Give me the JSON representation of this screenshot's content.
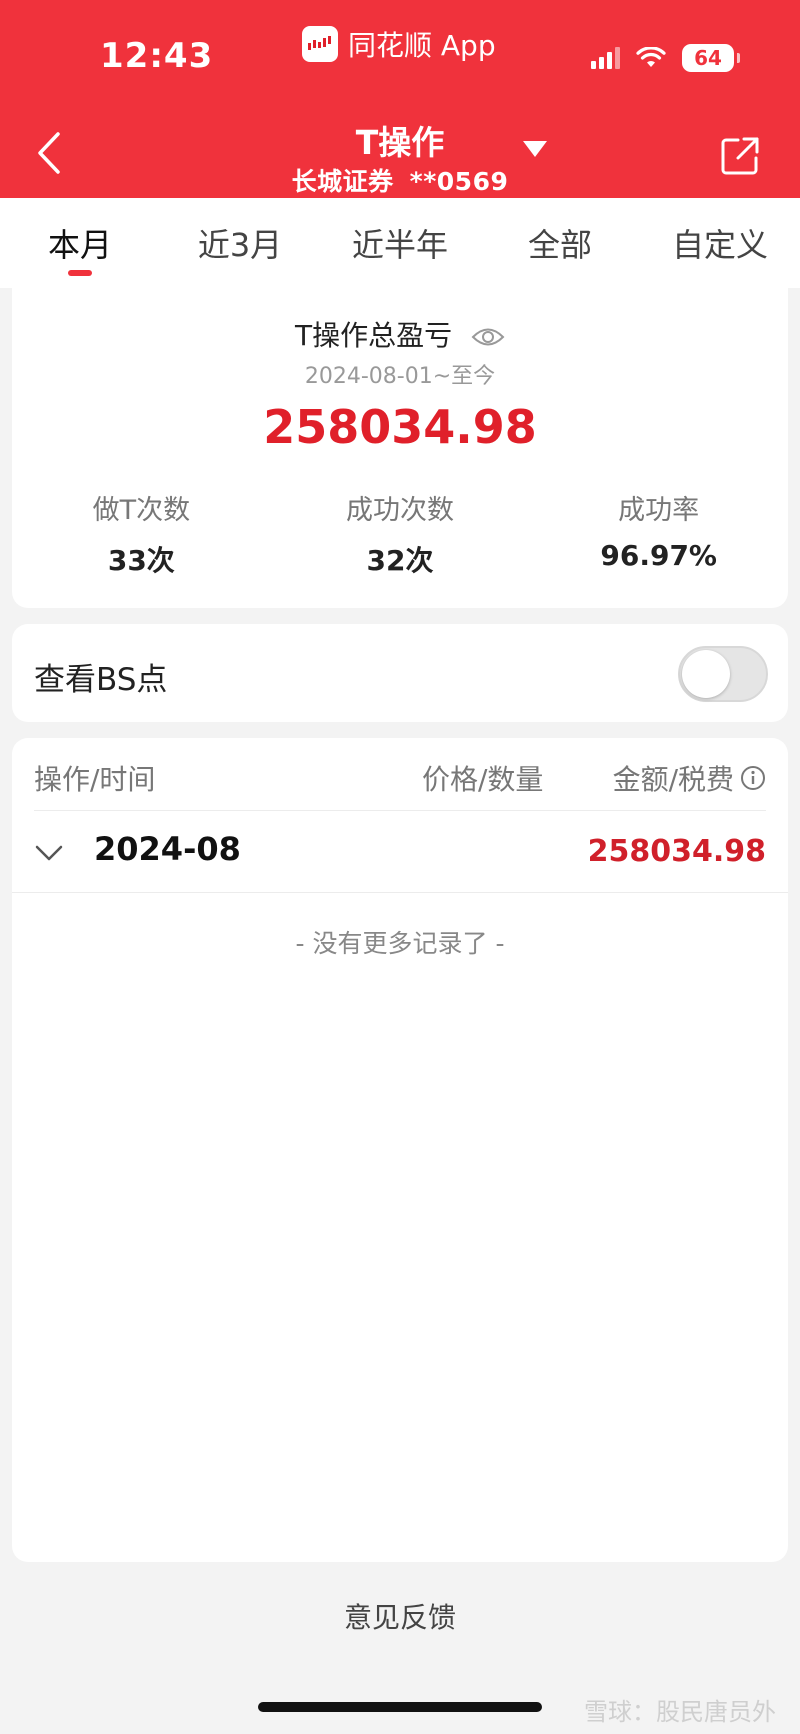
{
  "status_bar": {
    "time": "12:43",
    "app_name": "同花顺 App",
    "battery": "64"
  },
  "nav": {
    "title": "T操作",
    "broker": "长城证券",
    "account": "**0569"
  },
  "tabs": [
    {
      "label": "本月",
      "active": true
    },
    {
      "label": "近3月",
      "active": false
    },
    {
      "label": "近半年",
      "active": false
    },
    {
      "label": "全部",
      "active": false
    },
    {
      "label": "自定义",
      "active": false
    }
  ],
  "summary": {
    "title": "T操作总盈亏",
    "date_range": "2024-08-01~至今",
    "total": "258034.98",
    "stats": [
      {
        "label": "做T次数",
        "value": "33次"
      },
      {
        "label": "成功次数",
        "value": "32次"
      },
      {
        "label": "成功率",
        "value": "96.97%"
      }
    ]
  },
  "bs_toggle": {
    "label": "查看BS点",
    "on": false
  },
  "records": {
    "headers": {
      "col1": "操作/时间",
      "col2": "价格/数量",
      "col3": "金额/税费"
    },
    "month": "2024-08",
    "month_amount": "258034.98",
    "no_more": "- 没有更多记录了 -"
  },
  "footer": {
    "feedback": "意见反馈",
    "watermark": "雪球：股民唐员外"
  },
  "colors": {
    "brand_red": "#f0323c",
    "profit_red": "#e0202a"
  },
  "icons": [
    "back-arrow-icon",
    "dropdown-triangle-icon",
    "share-icon",
    "eye-icon",
    "info-icon",
    "chevron-down-icon"
  ]
}
